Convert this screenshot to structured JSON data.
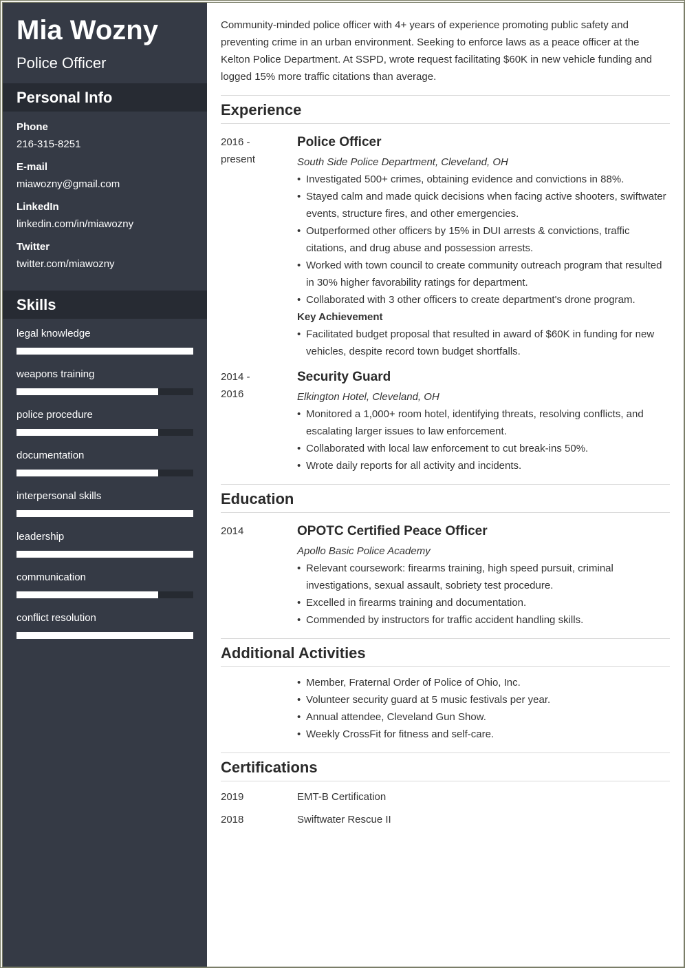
{
  "header": {
    "name": "Mia Wozny",
    "title": "Police Officer"
  },
  "personal_info": {
    "heading": "Personal Info",
    "items": [
      {
        "label": "Phone",
        "value": "216-315-8251"
      },
      {
        "label": "E-mail",
        "value": "miawozny@gmail.com"
      },
      {
        "label": "LinkedIn",
        "value": "linkedin.com/in/miawozny"
      },
      {
        "label": "Twitter",
        "value": "twitter.com/miawozny"
      }
    ]
  },
  "skills": {
    "heading": "Skills",
    "items": [
      {
        "label": "legal knowledge",
        "level": 1.0
      },
      {
        "label": "weapons training",
        "level": 0.8
      },
      {
        "label": "police procedure",
        "level": 0.8
      },
      {
        "label": "documentation",
        "level": 0.8
      },
      {
        "label": "interpersonal skills",
        "level": 1.0
      },
      {
        "label": "leadership",
        "level": 1.0
      },
      {
        "label": "communication",
        "level": 0.8
      },
      {
        "label": "conflict resolution",
        "level": 1.0
      }
    ]
  },
  "summary": "Community-minded police officer with 4+ years of experience promoting public safety and preventing crime in an urban environment. Seeking to enforce laws as a peace officer at the Kelton Police Department. At SSPD, wrote request facilitating $60K in new vehicle funding and logged 15% more traffic citations than average.",
  "experience": {
    "heading": "Experience",
    "entries": [
      {
        "date_line1": "2016 -",
        "date_line2": "present",
        "title": "Police Officer",
        "org": "South Side Police Department, Cleveland, OH",
        "bullets": [
          "Investigated 500+ crimes, obtaining evidence and convictions in 88%.",
          "Stayed calm and made quick decisions when facing active shooters, swiftwater events, structure fires, and other emergencies.",
          "Outperformed other officers by 15% in DUI arrests & convictions, traffic citations, and drug abuse and possession arrests.",
          "Worked with town council to create community outreach program that resulted in 30% higher favorability ratings for department.",
          "Collaborated with 3 other officers to create department's drone program."
        ],
        "key_achievement_label": "Key Achievement",
        "key_achievement_bullets": [
          "Facilitated budget proposal that resulted in award of $60K in funding for new vehicles, despite record town budget shortfalls."
        ]
      },
      {
        "date_line1": "2014 -",
        "date_line2": "2016",
        "title": "Security Guard",
        "org": "Elkington Hotel, Cleveland, OH",
        "bullets": [
          "Monitored a 1,000+ room hotel, identifying threats, resolving conflicts, and escalating larger issues to law enforcement.",
          "Collaborated with local law enforcement to cut break-ins 50%.",
          "Wrote daily reports for all activity and incidents."
        ]
      }
    ]
  },
  "education": {
    "heading": "Education",
    "entries": [
      {
        "date": "2014",
        "title": "OPOTC Certified Peace Officer",
        "org": "Apollo Basic Police Academy",
        "bullets": [
          "Relevant coursework: firearms training, high speed pursuit, criminal investigations, sexual assault, sobriety test procedure.",
          "Excelled in firearms training and documentation.",
          "Commended by instructors for traffic accident handling skills."
        ]
      }
    ]
  },
  "activities": {
    "heading": "Additional Activities",
    "bullets": [
      "Member, Fraternal Order of Police of Ohio, Inc.",
      "Volunteer security guard at 5 music festivals per year.",
      "Annual attendee, Cleveland Gun Show.",
      "Weekly CrossFit for fitness and self-care."
    ]
  },
  "certifications": {
    "heading": "Certifications",
    "items": [
      {
        "year": "2019",
        "name": "EMT-B Certification"
      },
      {
        "year": "2018",
        "name": "Swiftwater Rescue II"
      }
    ]
  }
}
